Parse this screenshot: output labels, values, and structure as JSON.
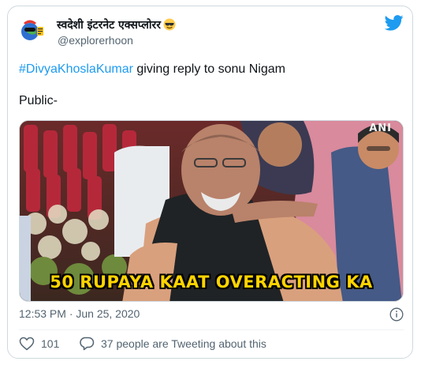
{
  "author": {
    "display_name": "स्वदेशी इंटरनेट एक्सप्लोरर",
    "emoji": "sunglasses-emoji",
    "handle": "@explorerhoon",
    "avatar": "cartoon-globe-avatar"
  },
  "brand_icon": "twitter-bird-icon",
  "tweet": {
    "hashtag": "#DivyaKhoslaKumar",
    "line1_rest": " giving reply to sonu Nigam",
    "line2": "Public-"
  },
  "media": {
    "caption": "50 RUPAYA KAAT OVERACTING KA",
    "watermark": "ANI"
  },
  "meta": {
    "timestamp": "12:53 PM · Jun 25, 2020"
  },
  "actions": {
    "like_count": "101",
    "reply_text": "37 people are Tweeting about this"
  },
  "colors": {
    "accent": "#1d9bf0",
    "text": "#0f1419",
    "muted": "#536471",
    "caption": "#ffd400",
    "like_icon": "#f91880"
  },
  "icons": [
    "heart-icon",
    "comment-bubble-icon",
    "info-icon"
  ]
}
